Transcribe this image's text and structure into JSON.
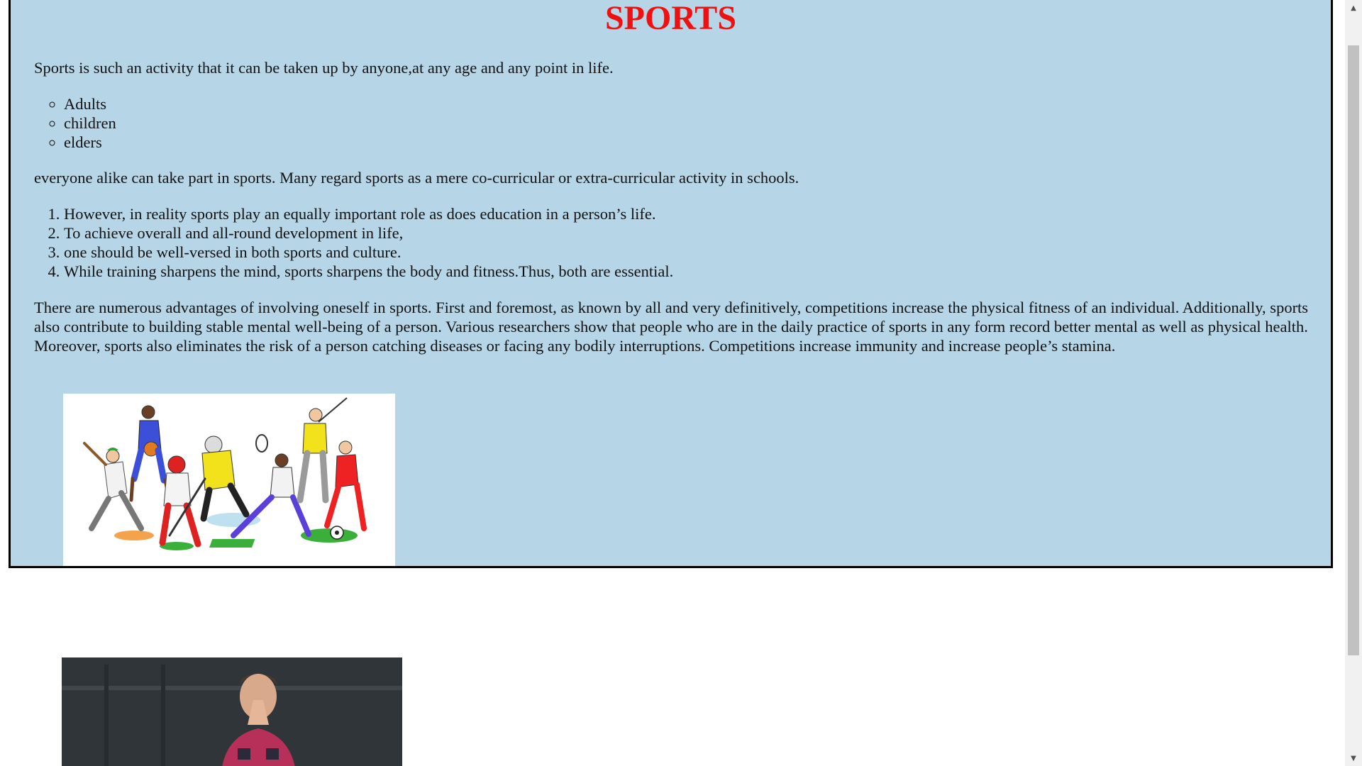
{
  "page": {
    "title": "SPORTS",
    "intro": "Sports is such an activity that it can be taken up by anyone,at any age and any point in life.",
    "bullets": [
      "Adults",
      "children",
      "elders"
    ],
    "para2": "everyone alike can take part in sports. Many regard sports as a mere co-curricular or extra-curricular activity in schools.",
    "numbered": [
      "However, in reality sports play an equally important role as does education in a person’s life.",
      "To achieve overall and all-round development in life,",
      "one should be well-versed in both sports and culture.",
      "While training sharpens the mind, sports sharpens the body and fitness.Thus, both are essential."
    ],
    "para3": "There are numerous advantages of involving oneself in sports. First and foremost, as known by all and very definitively, competitions increase the physical fitness of an individual. Additionally, sports also contribute to building stable mental well-being of a person. Various researchers show that people who are in the daily practice of sports in any form record better mental as well as physical health. Moreover, sports also eliminates the risk of a person catching diseases or facing any bodily interruptions. Competitions increase immunity and increase people’s stamina."
  },
  "colors": {
    "title": "#ee1111",
    "box_background": "#b6d6e8",
    "box_border": "#000000"
  },
  "icons": {
    "scroll_up": "triangle-up-icon",
    "scroll_down": "triangle-down-icon"
  }
}
